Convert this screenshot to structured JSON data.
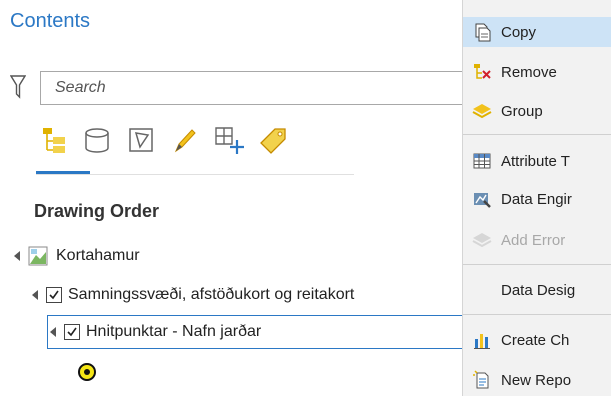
{
  "contents": {
    "title": "Contents",
    "search_placeholder": "Search",
    "tools": [
      "list-by-drawing-order-icon",
      "list-by-data-source-icon",
      "list-by-selection-icon",
      "list-by-editing-icon",
      "list-by-snapping-icon",
      "list-by-labeling-icon"
    ],
    "drawing_order_heading": "Drawing Order",
    "tree": [
      {
        "label": "Kortahamur",
        "type": "map"
      },
      {
        "label": "Samningssvæði, afstöðukort og reitakort",
        "type": "group",
        "checked": true
      },
      {
        "label": "Hnitpunktar - Nafn jarðar",
        "type": "layer",
        "checked": true,
        "selected": true
      }
    ]
  },
  "context_menu": {
    "items": [
      {
        "label": "Copy",
        "icon": "copy-icon",
        "highlighted": true
      },
      {
        "label": "Remove",
        "icon": "remove-icon"
      },
      {
        "label": "Group",
        "icon": "group-icon"
      },
      {
        "label": "Attribute T",
        "icon": "attribute-table-icon"
      },
      {
        "label": "Data Engir",
        "icon": "data-engineering-icon"
      },
      {
        "label": "Add Error",
        "icon": "add-error-layers-icon",
        "disabled": true
      },
      {
        "label": "Data Desig",
        "icon": ""
      },
      {
        "label": "Create Ch",
        "icon": "create-chart-icon"
      },
      {
        "label": "New Repo",
        "icon": "new-report-icon"
      }
    ]
  },
  "colors": {
    "accent": "#2b78c5",
    "highlight": "#cde3f6",
    "menu_bg": "#f2f2f2",
    "point_symbol": "#f5e616"
  }
}
